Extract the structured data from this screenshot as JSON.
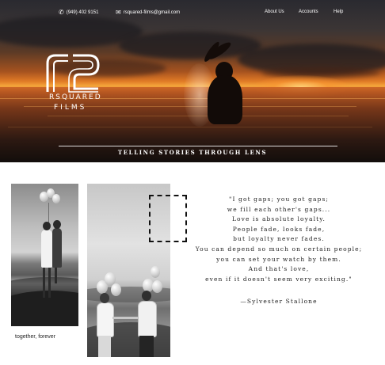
{
  "header": {
    "phone": "(949) 402 9151",
    "email": "rsquared-films@gmail.com",
    "phone_icon": "phone-icon",
    "email_icon": "envelope-icon",
    "nav": [
      {
        "label": "About Us"
      },
      {
        "label": "Accounts"
      },
      {
        "label": "Help"
      }
    ]
  },
  "logo": {
    "line1": "RSQUARED",
    "line2": "FILMS"
  },
  "hero": {
    "tagline": "TELLING STORIES THROUGH LENS"
  },
  "gallery": {
    "caption": "together, forever"
  },
  "quote": {
    "lines": [
      "\"I got gaps; you got gaps;",
      "we fill each other's gaps...",
      "Love is absolute loyalty.",
      "People fade, looks fade,",
      "but loyalty never fades.",
      "You can depend so much on certain people;",
      "you can set your watch by them.",
      "And that's love,",
      "even if it doesn't seem very exciting.\""
    ],
    "author": "—Sylvester Stallone"
  },
  "colors": {
    "text_dark": "#222222",
    "hero_orange": "#e07a26",
    "white": "#ffffff"
  }
}
